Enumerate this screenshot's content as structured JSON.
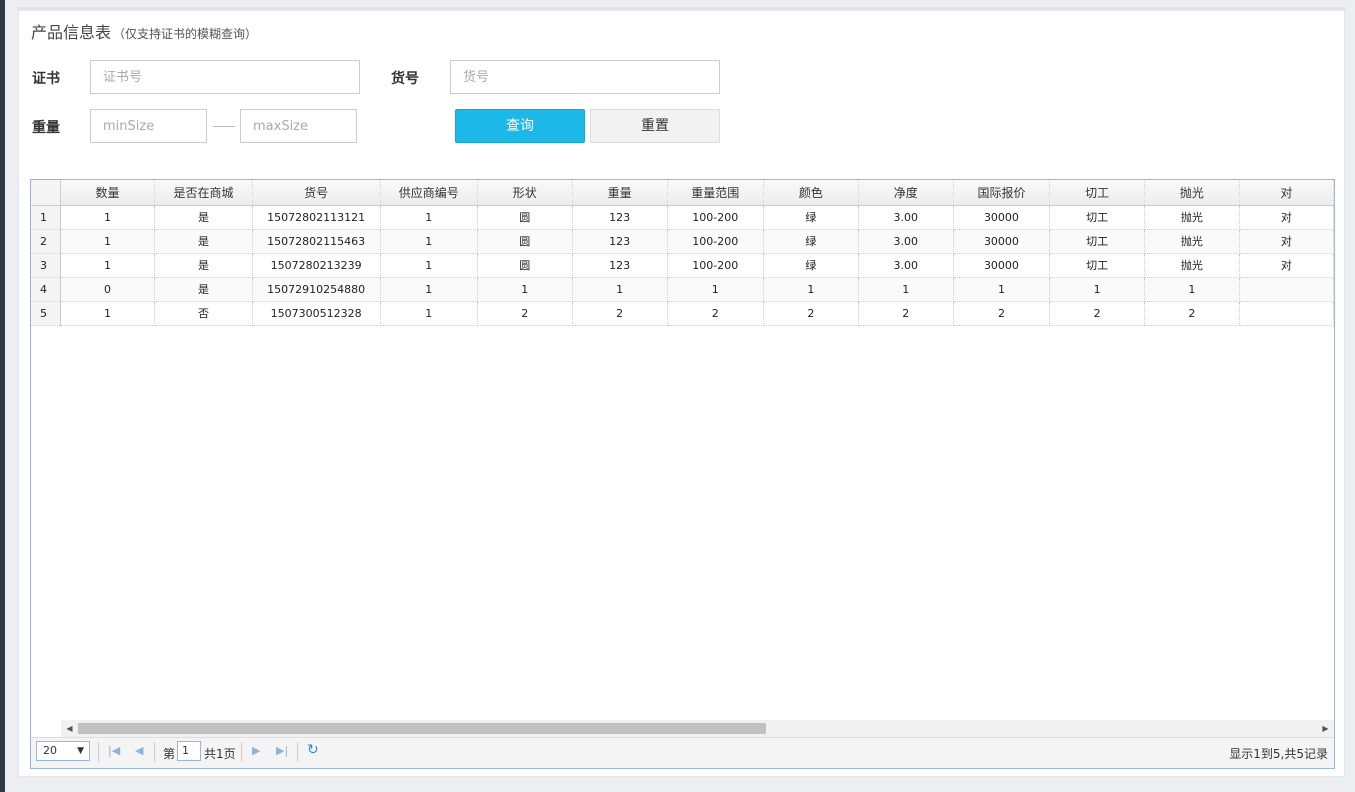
{
  "page": {
    "title": "产品信息表",
    "subtitle": "（仅支持证书的模糊查询）"
  },
  "form": {
    "certificate_label": "证书",
    "certificate_placeholder": "证书号",
    "item_no_label": "货号",
    "item_no_placeholder": "货号",
    "weight_label": "重量",
    "min_placeholder": "minSize",
    "max_placeholder": "maxSize",
    "query_button": "查询",
    "reset_button": "重置"
  },
  "colors": {
    "accent": "#1cb8e7",
    "grid_border": "#95b8e7"
  },
  "table": {
    "columns": [
      "数量",
      "是否在商城",
      "货号",
      "供应商编号",
      "形状",
      "重量",
      "重量范围",
      "颜色",
      "净度",
      "国际报价",
      "切工",
      "抛光",
      "对"
    ],
    "rows": [
      {
        "n": "1",
        "cells": [
          "1",
          "是",
          "15072802113121",
          "1",
          "圆",
          "123",
          "100-200",
          "绿",
          "3.00",
          "30000",
          "切工",
          "抛光",
          "对"
        ]
      },
      {
        "n": "2",
        "cells": [
          "1",
          "是",
          "15072802115463",
          "1",
          "圆",
          "123",
          "100-200",
          "绿",
          "3.00",
          "30000",
          "切工",
          "抛光",
          "对"
        ]
      },
      {
        "n": "3",
        "cells": [
          "1",
          "是",
          "1507280213239",
          "1",
          "圆",
          "123",
          "100-200",
          "绿",
          "3.00",
          "30000",
          "切工",
          "抛光",
          "对"
        ]
      },
      {
        "n": "4",
        "cells": [
          "0",
          "是",
          "15072910254880",
          "1",
          "1",
          "1",
          "1",
          "1",
          "1",
          "1",
          "1",
          "1",
          ""
        ]
      },
      {
        "n": "5",
        "cells": [
          "1",
          "否",
          "1507300512328",
          "1",
          "2",
          "2",
          "2",
          "2",
          "2",
          "2",
          "2",
          "2",
          ""
        ]
      }
    ]
  },
  "pager": {
    "page_size": "20",
    "page_prefix": "第",
    "page_number": "1",
    "page_total": "共1页",
    "summary": "显示1到5,共5记录"
  }
}
